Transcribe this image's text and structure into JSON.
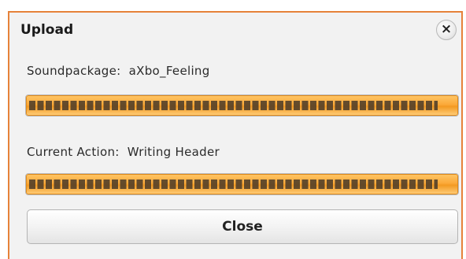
{
  "dialog": {
    "title": "Upload",
    "close_icon": "close-icon",
    "close_glyph": "×"
  },
  "soundpackage": {
    "label": "Soundpackage:",
    "value": "aXbo_Feeling",
    "progress_fraction": 1.0
  },
  "current_action": {
    "label": "Current Action:",
    "value": "Writing Header",
    "progress_fraction": 1.0
  },
  "buttons": {
    "close_label": "Close"
  },
  "colors": {
    "accent_border": "#e6823a",
    "progress_orange": "#fba93a"
  }
}
